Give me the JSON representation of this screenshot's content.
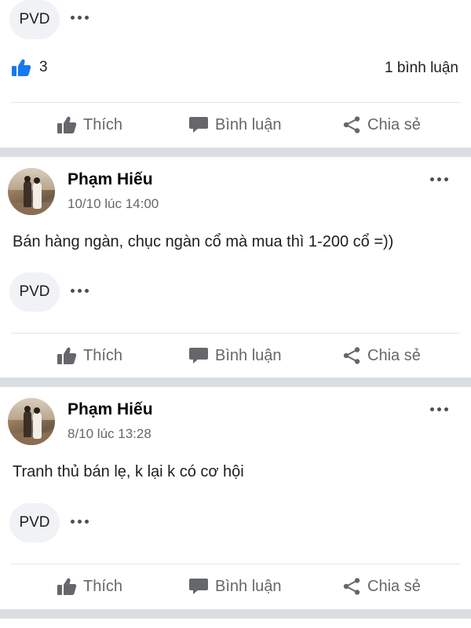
{
  "colors": {
    "like_blue": "#1877f2",
    "muted": "#65676b",
    "separator": "#dadde1"
  },
  "top_post": {
    "reaction_chip": "PVD",
    "like_count": "3",
    "comment_count": "1 bình luận"
  },
  "actions": {
    "like": "Thích",
    "comment": "Bình luận",
    "share": "Chia sẻ"
  },
  "posts": [
    {
      "author": "Phạm Hiếu",
      "time": "10/10 lúc 14:00",
      "text": "Bán hàng ngàn, chục ngàn cổ mà mua thì 1-200 cổ =))",
      "reaction_chip": "PVD"
    },
    {
      "author": "Phạm Hiếu",
      "time": "8/10 lúc 13:28",
      "text": "Tranh thủ bán lẹ, k lại k có cơ hội",
      "reaction_chip": "PVD"
    }
  ]
}
